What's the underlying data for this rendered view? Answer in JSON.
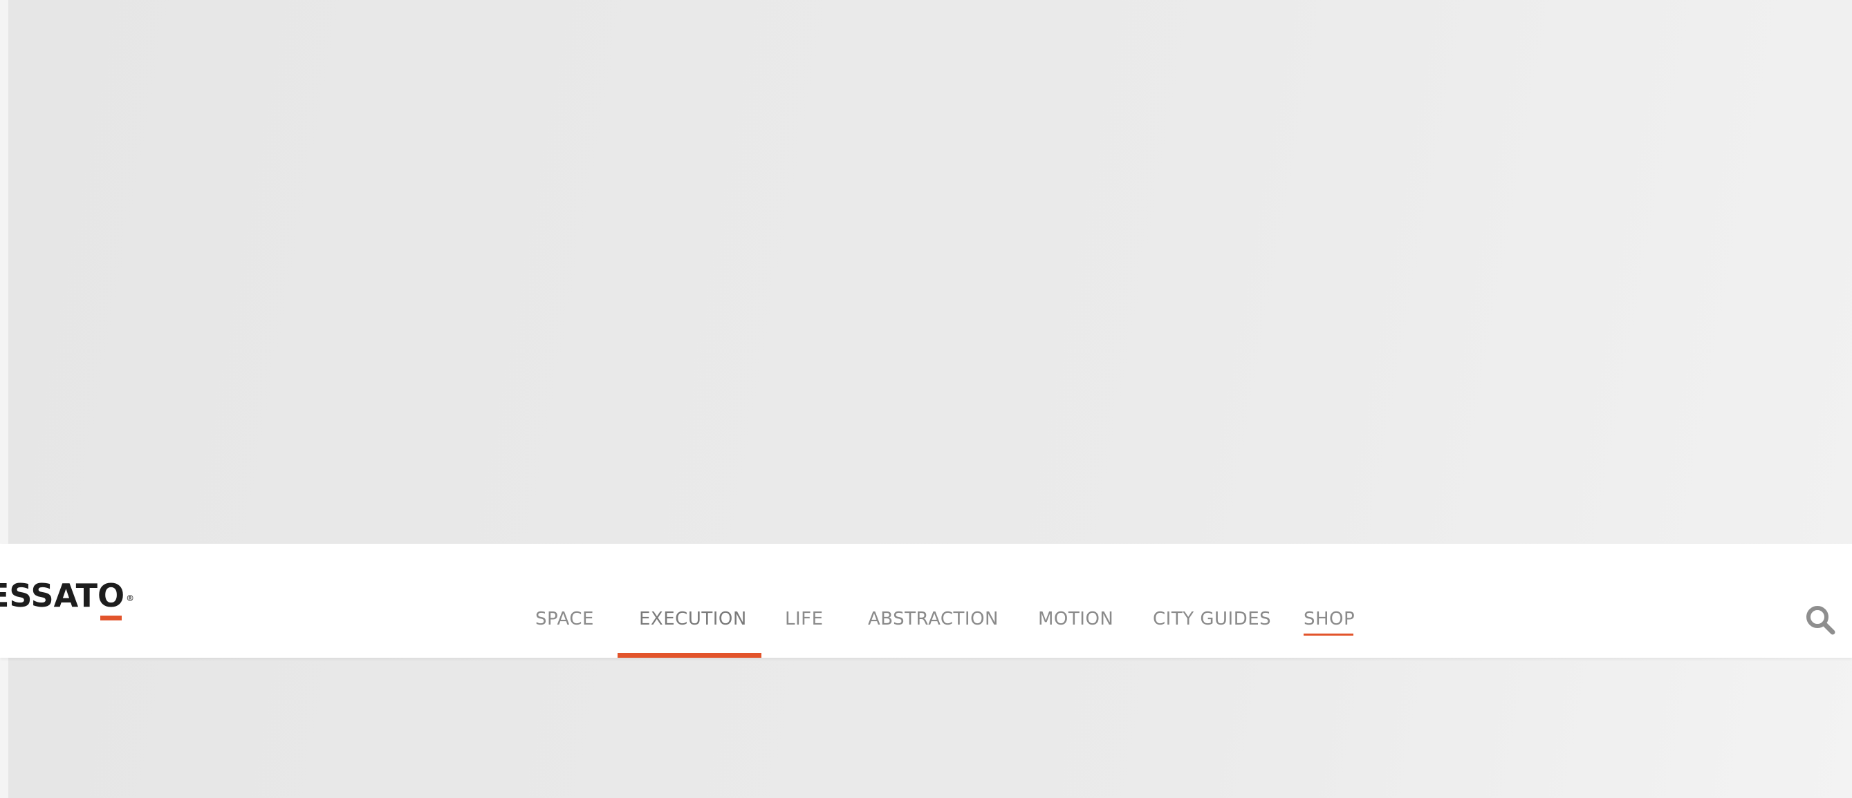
{
  "brand": {
    "logo_main": "ESSAT",
    "logo_o": "O",
    "logo_reg": "®",
    "accent_color": "#e2542b"
  },
  "nav": {
    "items": [
      {
        "label": "SPACE",
        "active": false
      },
      {
        "label": "EXECUTION",
        "active": true
      },
      {
        "label": "LIFE",
        "active": false
      },
      {
        "label": "ABSTRACTION",
        "active": false
      },
      {
        "label": "MOTION",
        "active": false
      },
      {
        "label": "CITY GUIDES",
        "active": false
      },
      {
        "label": "SHOP",
        "active": false
      }
    ],
    "search_icon": "search-icon"
  }
}
